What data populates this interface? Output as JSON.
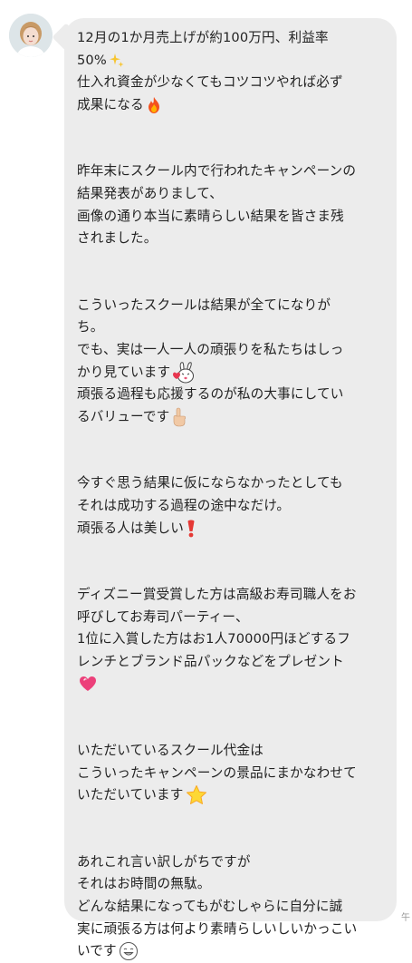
{
  "message": {
    "paragraphs": [
      [
        "12月の1か月売上げが約100万円、利益率",
        "50%",
        "仕入れ資金が少なくてもコツコツやれば必ず",
        "成果になる"
      ],
      [
        "昨年末にスクール内で行われたキャンペーンの",
        "結果発表がありまして、",
        "画像の通り本当に素晴らしい結果を皆さま残",
        "されました。"
      ],
      [
        "こういったスクールは結果が全てになりが",
        "ち。",
        "でも、実は一人一人の頑張りを私たちはしっ",
        "かり見ています",
        "頑張る過程も応援するのが私の大事にしてい",
        "るバリューです"
      ],
      [
        "今すぐ思う結果に仮にならなかったとしても",
        "それは成功する過程の途中なだけ。",
        "頑張る人は美しい"
      ],
      [
        "ディズニー賞受賞した方は高級お寿司職人をお",
        "呼びしてお寿司パーティー、",
        "1位に入賞した方はお1人70000円ほどするフ",
        "レンチとブランド品パックなどをプレゼント",
        ""
      ],
      [
        "いただいているスクール代金は",
        "こういったキャンペーンの景品にまかなわせて",
        "いただいています"
      ],
      [
        "あれこれ言い訳しがちですが",
        "それはお時間の無駄。",
        "どんな結果になってもがむしゃらに自分に誠",
        "実に頑張る方は何より素晴らしいしいかっこい",
        "いです"
      ]
    ],
    "timestamp_fragment": "午",
    "icons": [
      "sparkles-icon",
      "fire-icon",
      "kiss-bunny-sticker-icon",
      "pointing-up-hand-icon",
      "exclamation-icon",
      "heart-icon",
      "star-icon",
      "smile-face-icon"
    ]
  },
  "colors": {
    "bubble": "#ececec",
    "text": "#222222",
    "background": "#ffffff"
  }
}
